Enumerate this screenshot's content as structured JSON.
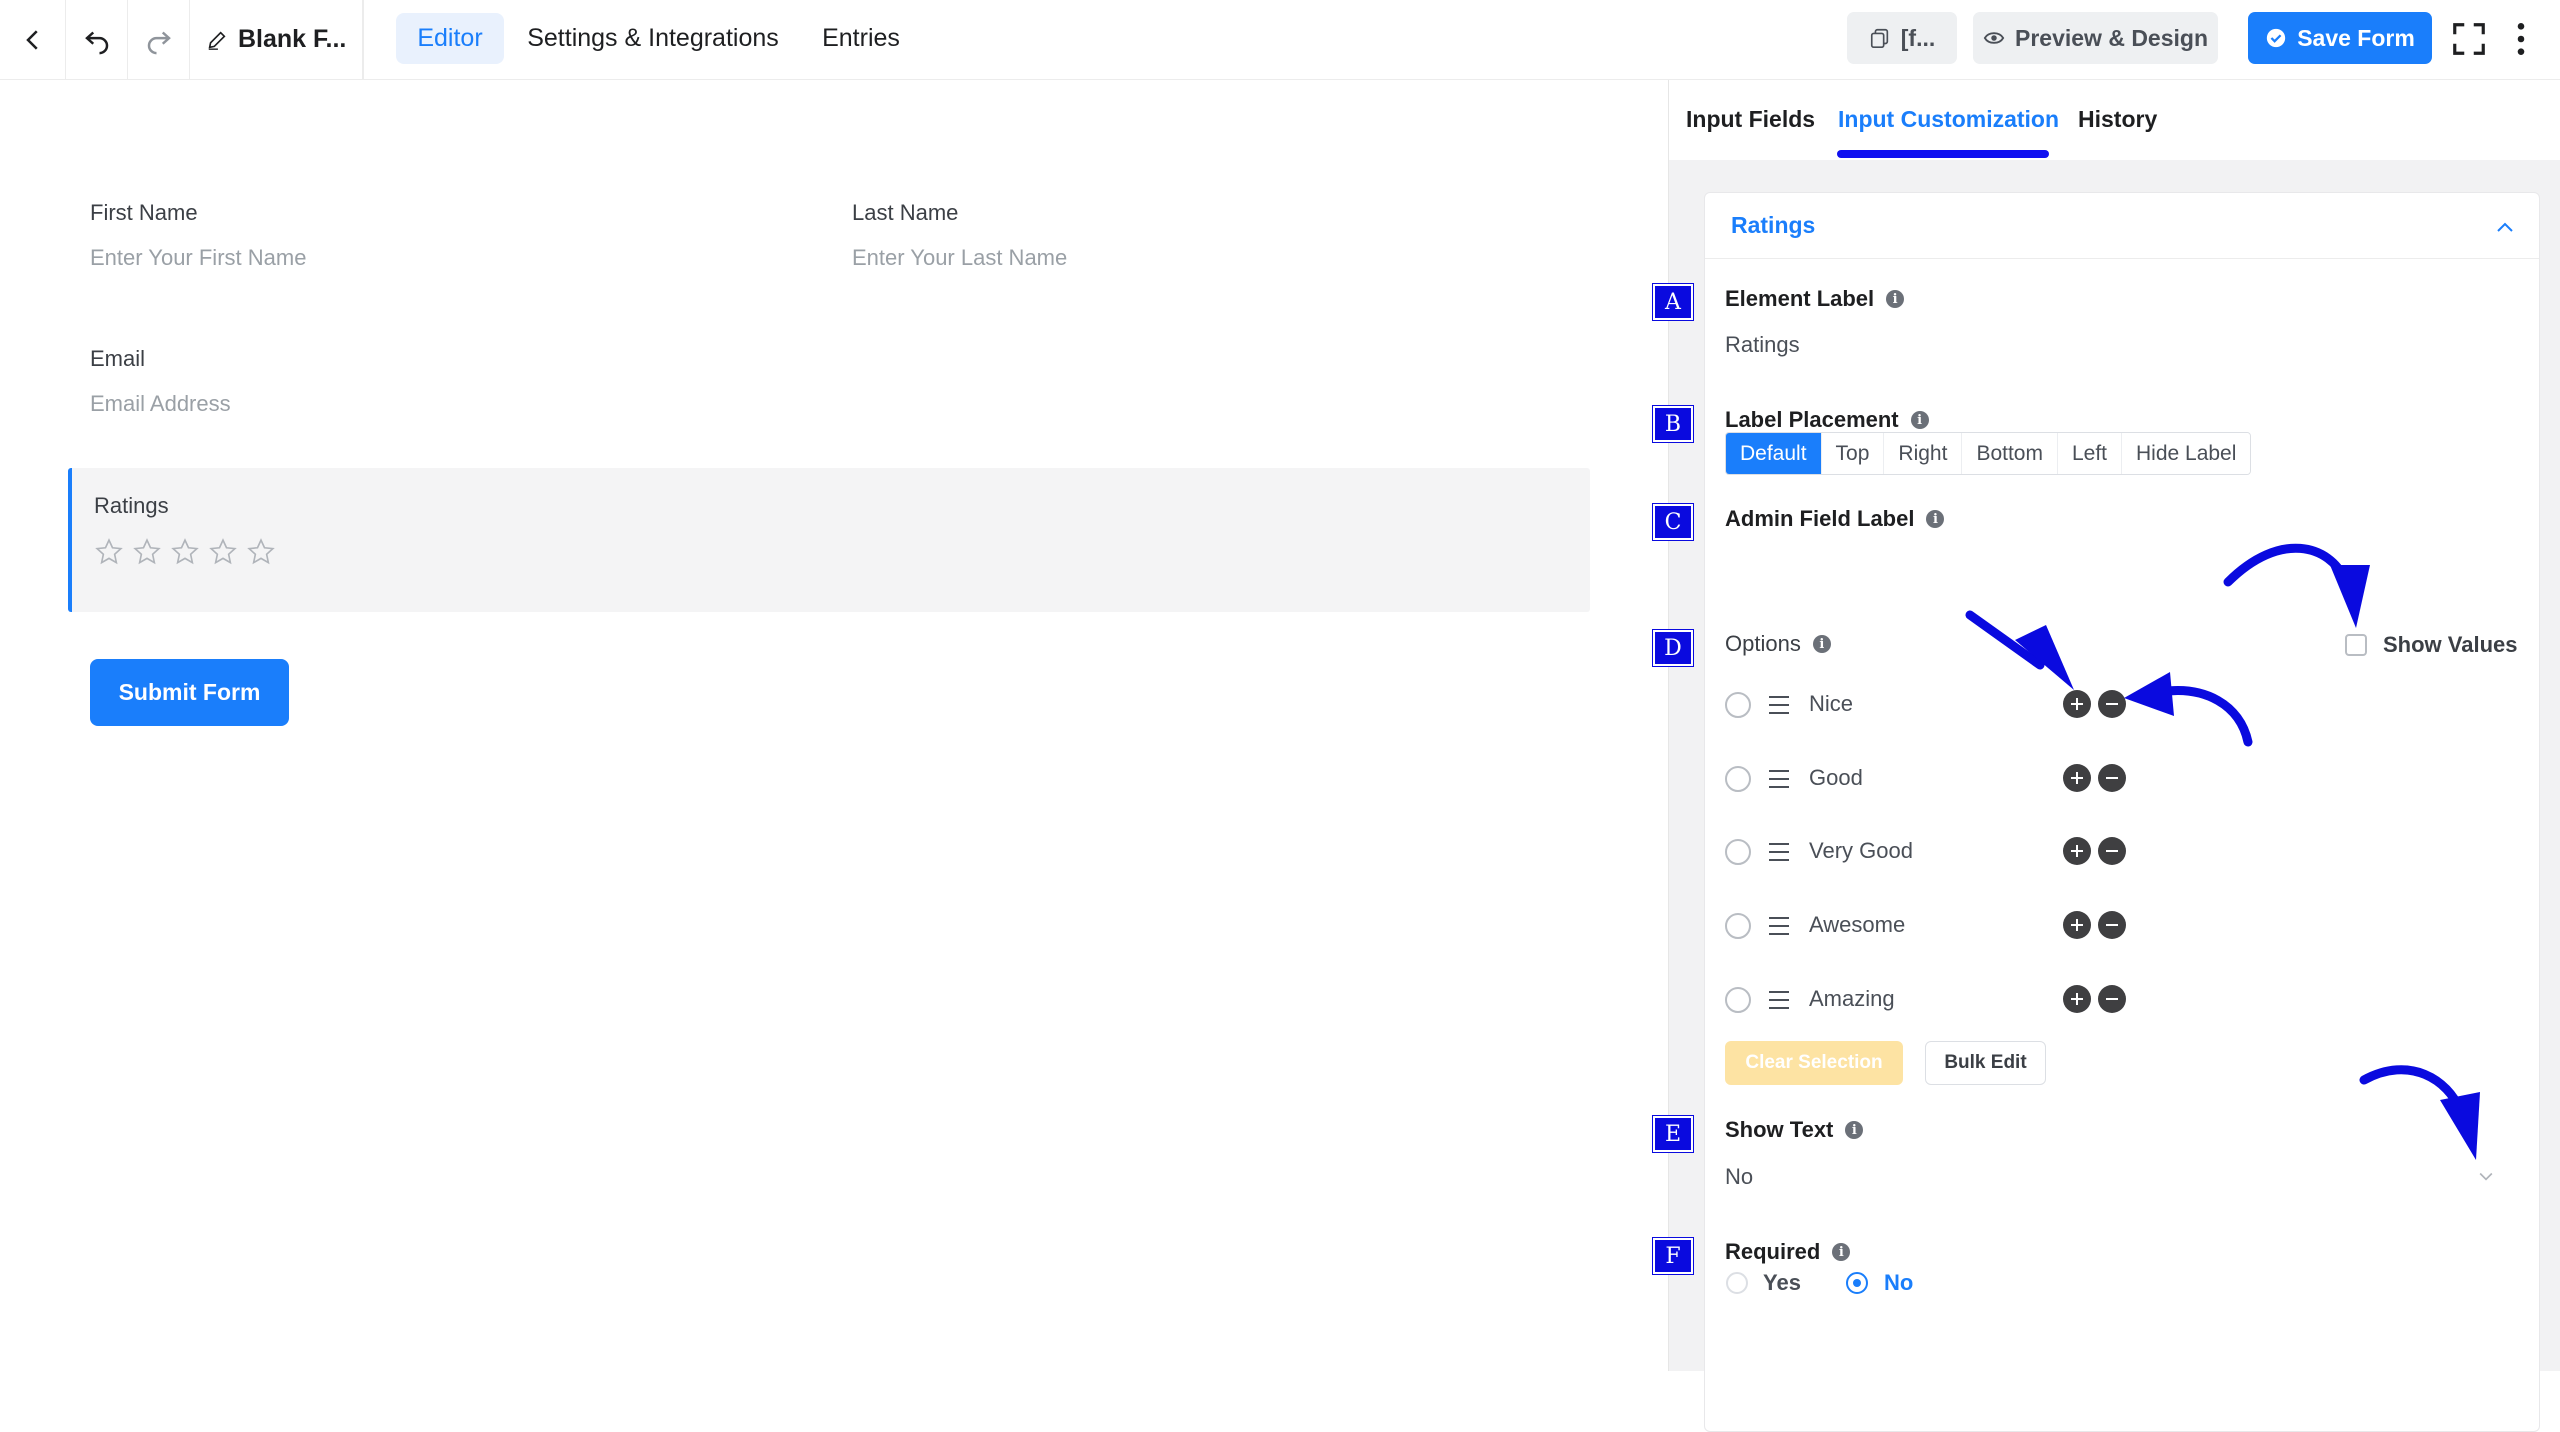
{
  "topbar": {
    "form_title": "Blank F...",
    "tabs": [
      "Editor",
      "Settings & Integrations",
      "Entries"
    ],
    "shortcode_label": "[f...",
    "preview_label": "Preview & Design",
    "save_label": "Save Form"
  },
  "form": {
    "first_name": {
      "label": "First Name",
      "placeholder": "Enter Your First Name"
    },
    "last_name": {
      "label": "Last Name",
      "placeholder": "Enter Your Last Name"
    },
    "email": {
      "label": "Email",
      "placeholder": "Email Address"
    },
    "ratings": {
      "label": "Ratings",
      "stars": 5
    },
    "submit_label": "Submit Form"
  },
  "panel": {
    "tabs": [
      "Input Fields",
      "Input Customization",
      "History"
    ],
    "section_title": "Ratings",
    "element_label": {
      "label": "Element Label",
      "value": "Ratings"
    },
    "label_placement": {
      "label": "Label Placement",
      "options": [
        "Default",
        "Top",
        "Right",
        "Bottom",
        "Left",
        "Hide Label"
      ],
      "selected": "Default"
    },
    "admin_field_label": {
      "label": "Admin Field Label"
    },
    "options": {
      "label": "Options",
      "show_values_label": "Show Values",
      "items": [
        "Nice",
        "Good",
        "Very Good",
        "Awesome",
        "Amazing"
      ],
      "clear_label": "Clear Selection",
      "bulk_label": "Bulk Edit"
    },
    "show_text": {
      "label": "Show Text",
      "value": "No"
    },
    "required": {
      "label": "Required",
      "yes": "Yes",
      "no": "No",
      "selected": "No"
    }
  },
  "badges": [
    "A",
    "B",
    "C",
    "D",
    "E",
    "F"
  ],
  "colors": {
    "accent": "#1a7efb",
    "annotation": "#0a0adf"
  }
}
